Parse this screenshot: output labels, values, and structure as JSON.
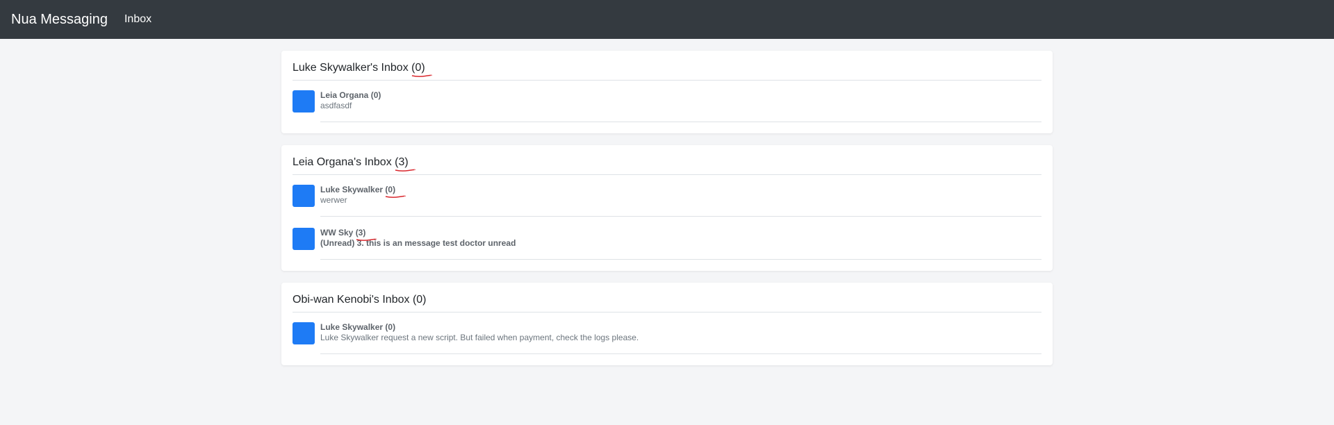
{
  "navbar": {
    "brand": "Nua Messaging",
    "links": [
      "Inbox"
    ]
  },
  "inboxes": [
    {
      "owner_title": "Luke Skywalker's Inbox",
      "count": "(0)",
      "annotated": true,
      "messages": [
        {
          "sender": "Leia Organa",
          "count": "(0)",
          "preview": "asdfasdf",
          "unread": false,
          "annotated": false
        }
      ]
    },
    {
      "owner_title": "Leia Organa's Inbox",
      "count": "(3)",
      "annotated": true,
      "messages": [
        {
          "sender": "Luke Skywalker",
          "count": "(0)",
          "preview": "werwer",
          "unread": false,
          "annotated": true
        },
        {
          "sender": "WW Sky",
          "count": "(3)",
          "preview": "(Unread) 3. this is an message test doctor unread",
          "unread": true,
          "annotated": true
        }
      ]
    },
    {
      "owner_title": "Obi-wan Kenobi's Inbox",
      "count": "(0)",
      "annotated": false,
      "messages": [
        {
          "sender": "Luke Skywalker",
          "count": "(0)",
          "preview": "Luke Skywalker request a new script. But failed when payment, check the logs please.",
          "unread": false,
          "annotated": false
        }
      ]
    }
  ],
  "colors": {
    "navbar_bg": "#343a40",
    "avatar": "#1e7bf5",
    "annotation_mark": "#d9262c"
  }
}
